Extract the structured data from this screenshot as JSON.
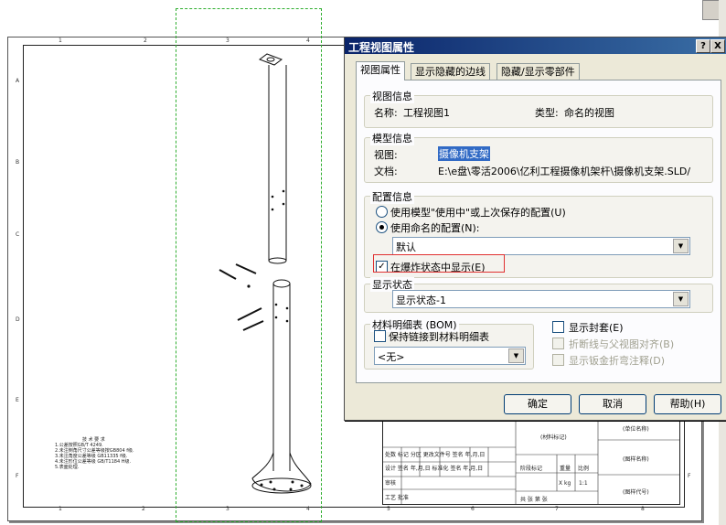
{
  "drawing": {
    "col_labels": [
      "1",
      "2",
      "3",
      "4",
      "5",
      "6",
      "7",
      "8"
    ],
    "row_labels": [
      "A",
      "B",
      "C",
      "D",
      "E",
      "F"
    ],
    "tech_notes": {
      "title": "技 术 要 求",
      "lines": [
        "1.公差按照GB/T 4249.",
        "2.未注倒角尺寸公差等级按GB804 f级.",
        "3.未注角度公差等级 GB11335 f级.",
        "4.未注形位公差等级 GB/T1184 H级.",
        "5.表面处理."
      ]
    },
    "title_block": {
      "material_mark": "(材料标记)",
      "unit_name": "(单位名称)",
      "drawing_name": "(图样名称)",
      "drawing_code": "(图样代号)",
      "rows": [
        "处数 标记 分区 更改文件号 签名 年,月,日",
        "设计 签名 年,月,日 标准化 签名 年,月,日",
        "审核",
        "工艺 批准"
      ],
      "stage_mark": "阶段标记",
      "weight": "重量",
      "scale": "比例",
      "weight_val": "X kg",
      "scale_val": "1:1",
      "sheet_total": "共 张 第 张"
    }
  },
  "dialog": {
    "title": "工程视图属性",
    "help_glyph": "?",
    "close_glyph": "X",
    "tabs": [
      "视图属性",
      "显示隐藏的边线",
      "隐藏/显示零部件"
    ],
    "view_info": {
      "title": "视图信息",
      "name_label": "名称:",
      "name_value": "工程视图1",
      "type_label": "类型:",
      "type_value": "命名的视图"
    },
    "model_info": {
      "title": "模型信息",
      "view_label": "视图:",
      "view_value": "摄像机支架",
      "doc_label": "文档:",
      "doc_value": "E:\\e盘\\零活2006\\亿利工程摄像机架杆\\摄像机支架.SLD/"
    },
    "config": {
      "title": "配置信息",
      "opt_in_use": "使用模型\"使用中\"或上次保存的配置(U)",
      "opt_named": "使用命名的配置(N):",
      "selected_config": "默认",
      "exploded_label": "在爆炸状态中显示(E)",
      "exploded_checked": true
    },
    "display_state": {
      "title": "显示状态",
      "value": "显示状态-1"
    },
    "bom": {
      "title": "材料明细表 (BOM)",
      "keep_link": "保持链接到材料明细表",
      "value": "<无>"
    },
    "right_options": {
      "show_envelope": "显示封套(E)",
      "align_break": "折断线与父视图对齐(B)",
      "show_sheetmetal": "显示钣金折弯注释(D)"
    },
    "buttons": {
      "ok": "确定",
      "cancel": "取消",
      "help": "帮助(H)"
    }
  }
}
